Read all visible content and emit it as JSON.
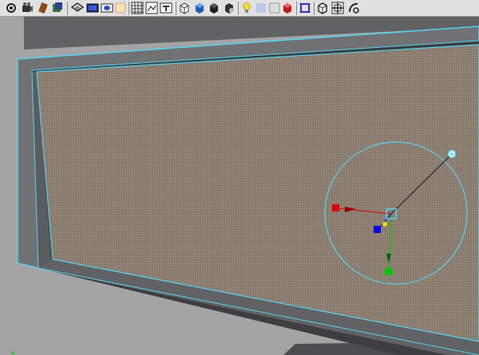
{
  "toolbar": {
    "tools": [
      {
        "name": "render-settings-icon"
      },
      {
        "name": "render-frame-icon"
      },
      {
        "name": "hypershade-icon"
      },
      {
        "name": "layer-editor-icon"
      },
      {
        "name": "uv-editor-icon"
      },
      {
        "name": "graph-editor-icon"
      },
      {
        "name": "playblast-icon"
      },
      {
        "name": "wireframe-shading-icon"
      },
      {
        "name": "smooth-shading-icon"
      },
      {
        "name": "textured-icon"
      },
      {
        "name": "grid-icon"
      },
      {
        "name": "camera-view-icon"
      },
      {
        "name": "image-plane-icon"
      },
      {
        "name": "frame-all-icon"
      },
      {
        "name": "display-cube-icon"
      },
      {
        "name": "shaded-cube-icon"
      },
      {
        "name": "default-light-icon"
      },
      {
        "name": "shadows-icon"
      },
      {
        "name": "x-ray-icon"
      },
      {
        "name": "backface-icon"
      },
      {
        "name": "isolate-select-icon"
      },
      {
        "name": "wireframe-on-shaded-icon"
      },
      {
        "name": "resolution-gate-icon"
      },
      {
        "name": "film-gate-icon"
      }
    ]
  },
  "colors": {
    "toolbar_bg": "#e1e1e1",
    "viewport_bg": "#a4a4a4",
    "frame_gray": "#707274",
    "frame_dark": "#3c3e40",
    "surface_brown": "#85786b",
    "selection_cyan": "#54d4ee",
    "axis_x": "#e00000",
    "axis_y": "#00c800",
    "axis_z": "#0000e0",
    "axis_center": "#e8e000"
  }
}
